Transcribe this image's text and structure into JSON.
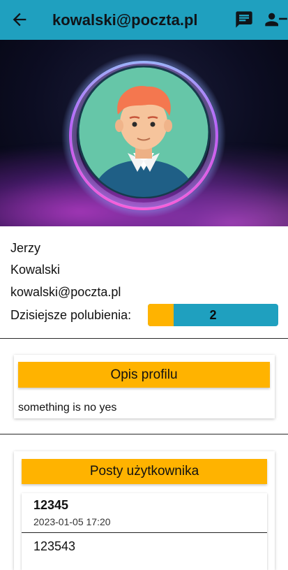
{
  "appbar": {
    "title": "kowalski@poczta.pl",
    "back_icon": "arrow-back-icon",
    "message_icon": "chat-icon",
    "person_icon": "person-remove-icon",
    "color": "#1fa0bf"
  },
  "profile": {
    "first_name": "Jerzy",
    "last_name": "Kowalski",
    "email": "kowalski@poczta.pl",
    "likes_label": "Dzisiejsze polubienia:",
    "likes_value": "2",
    "likes_fill_fraction": 0.2,
    "accent": "#ffb300"
  },
  "description": {
    "header": "Opis profilu",
    "text": "something is no yes"
  },
  "posts": {
    "header": "Posty użytkownika",
    "items": [
      {
        "title": "12345",
        "date": "2023-01-05 17:20",
        "body": "123543"
      }
    ]
  }
}
